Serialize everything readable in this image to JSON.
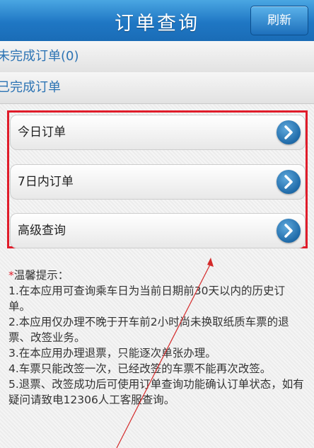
{
  "header": {
    "title": "订单查询",
    "refresh_label": "刷新"
  },
  "sections": {
    "incomplete": "未完成订单(0)",
    "completed": "已完成订单"
  },
  "menu": {
    "items": [
      {
        "label": "今日订单",
        "icon": "chevron-right-icon"
      },
      {
        "label": "7日内订单",
        "icon": "chevron-right-icon"
      },
      {
        "label": "高级查询",
        "icon": "chevron-right-icon"
      }
    ]
  },
  "tips": {
    "star": "*",
    "title": "温馨提示：",
    "lines": [
      "1.在本应用可查询乘车日为当前日期前30天以内的历史订单。",
      "2.本应用仅办理不晚于开车前2小时尚未换取纸质车票的退票、改签业务。",
      "3.在本应用办理退票，只能逐次单张办理。",
      "4.车票只能改签一次，已经改签的车票不能再次改签。",
      "5.退票、改签成功后可使用订单查询功能确认订单状态，如有疑问请致电12306人工客服查询。"
    ]
  },
  "colors": {
    "header_blue": "#1f77c4",
    "section_text": "#2d74b4",
    "highlight_red": "#e01c2a"
  }
}
